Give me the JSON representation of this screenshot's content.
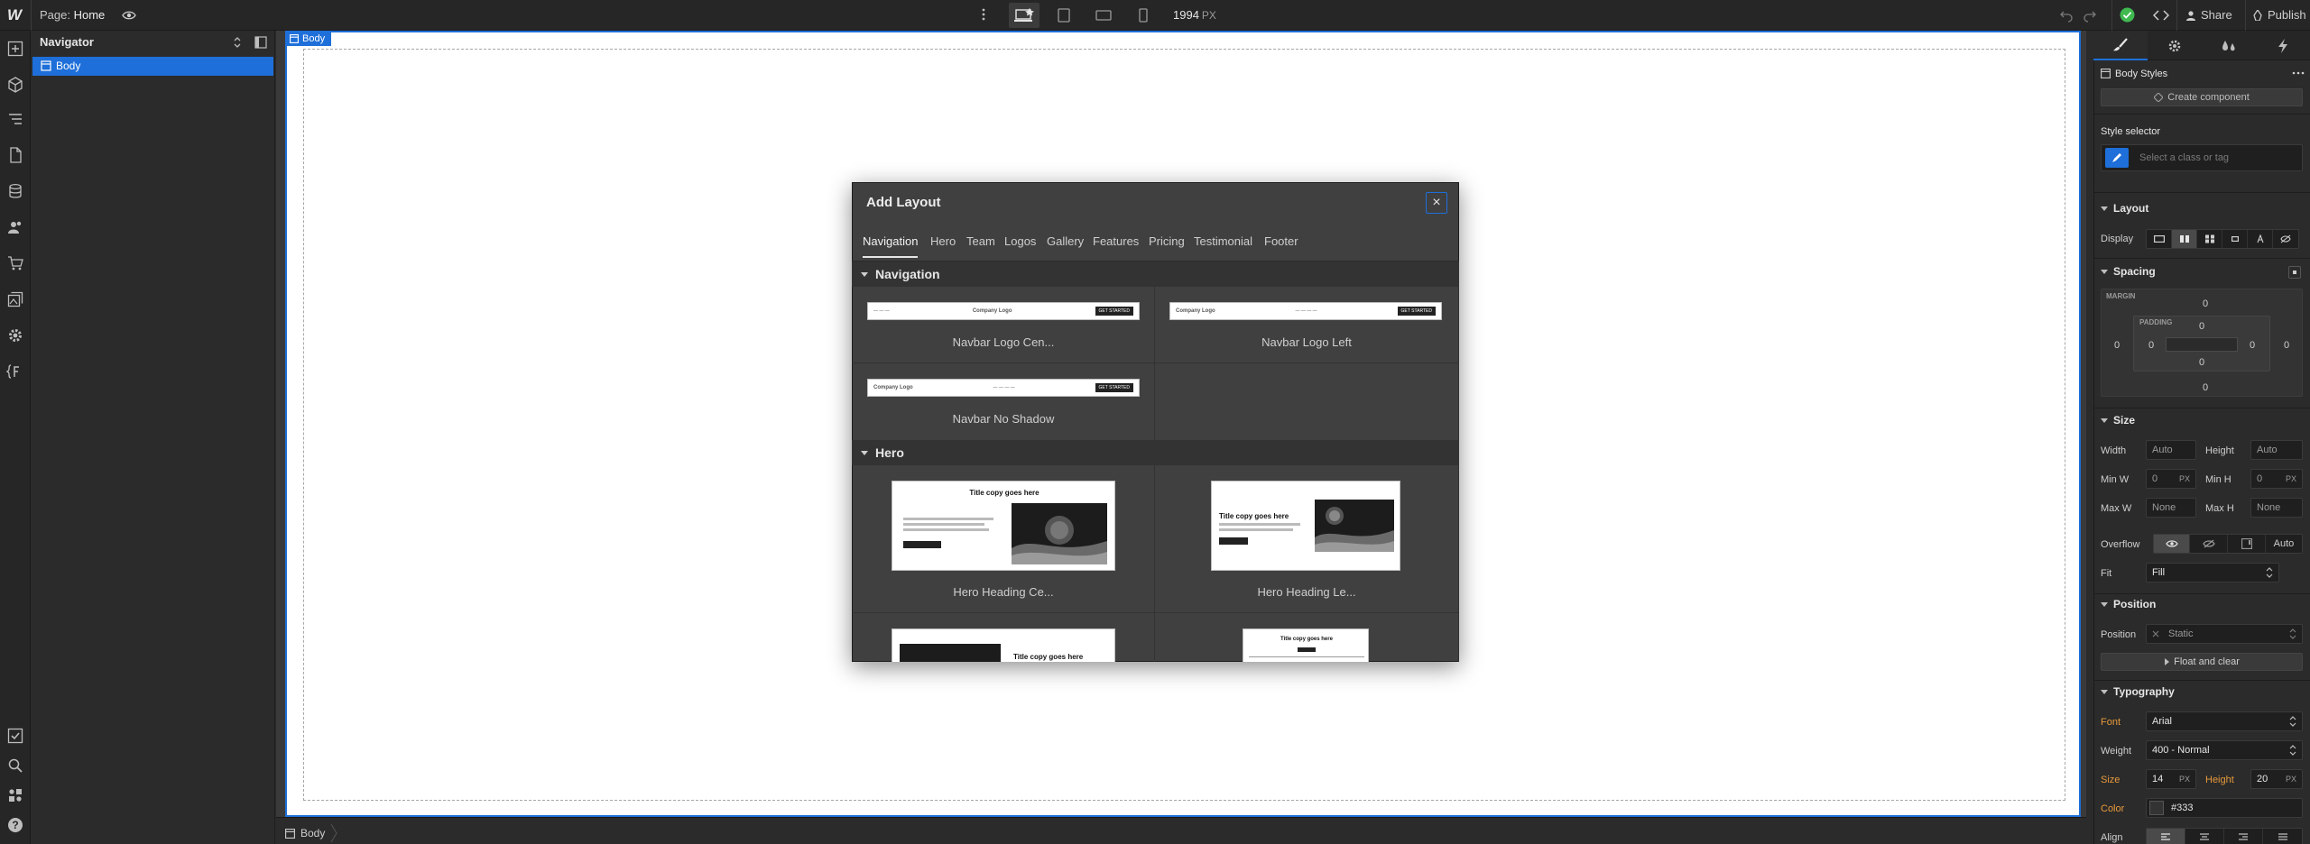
{
  "topbar": {
    "logo": "W",
    "page_prefix": "Page:",
    "page_name": "Home",
    "width_value": "1994",
    "width_unit": "PX",
    "share_label": "Share",
    "publish_label": "Publish"
  },
  "navigator": {
    "title": "Navigator",
    "tree_item": "Body"
  },
  "canvas": {
    "selected_tag": "Body",
    "breadcrumb": "Body"
  },
  "modal": {
    "title": "Add Layout",
    "close": "×",
    "tabs": [
      "Navigation",
      "Hero",
      "Team",
      "Logos",
      "Gallery",
      "Features",
      "Pricing",
      "Testimonial",
      "Footer"
    ],
    "sections": [
      {
        "name": "Navigation",
        "items": [
          "Navbar Logo Cen...",
          "Navbar Logo Left",
          "Navbar No Shadow"
        ]
      },
      {
        "name": "Hero",
        "items": [
          "Hero Heading Ce...",
          "Hero Heading Le..."
        ]
      }
    ],
    "preview_text": {
      "company_logo": "Company Logo",
      "title_copy": "Title copy goes here",
      "cta": "GET STARTED"
    }
  },
  "style_panel": {
    "element_title": "Body Styles",
    "create_component": "Create component",
    "style_selector_label": "Style selector",
    "selector_placeholder": "Select a class or tag",
    "layout": {
      "heading": "Layout",
      "display_label": "Display"
    },
    "spacing": {
      "heading": "Spacing",
      "margin_label": "MARGIN",
      "padding_label": "PADDING",
      "margin_top": "0",
      "margin_left": "0",
      "margin_right": "0",
      "margin_bottom": "0",
      "padding_top": "0",
      "padding_left": "0",
      "padding_right": "0",
      "padding_bottom": "0"
    },
    "size": {
      "heading": "Size",
      "width_label": "Width",
      "width_value": "Auto",
      "height_label": "Height",
      "height_value": "Auto",
      "minw_label": "Min W",
      "minw_value": "0",
      "minw_unit": "PX",
      "minh_label": "Min H",
      "minh_value": "0",
      "minh_unit": "PX",
      "maxw_label": "Max W",
      "maxw_value": "None",
      "maxh_label": "Max H",
      "maxh_value": "None",
      "overflow_label": "Overflow",
      "overflow_auto": "Auto",
      "fit_label": "Fit",
      "fit_value": "Fill"
    },
    "position": {
      "heading": "Position",
      "position_label": "Position",
      "position_value": "Static",
      "float_clear": "Float and clear"
    },
    "typography": {
      "heading": "Typography",
      "font_label": "Font",
      "font_value": "Arial",
      "weight_label": "Weight",
      "weight_value": "400 - Normal",
      "size_label": "Size",
      "size_value": "14",
      "size_unit": "PX",
      "height_label": "Height",
      "height_value": "20",
      "height_unit": "PX",
      "color_label": "Color",
      "color_value": "#333",
      "align_label": "Align"
    }
  },
  "colors": {
    "accent": "#1e6fd9",
    "status_ok": "#3fb950",
    "modified": "#e89a3c"
  }
}
